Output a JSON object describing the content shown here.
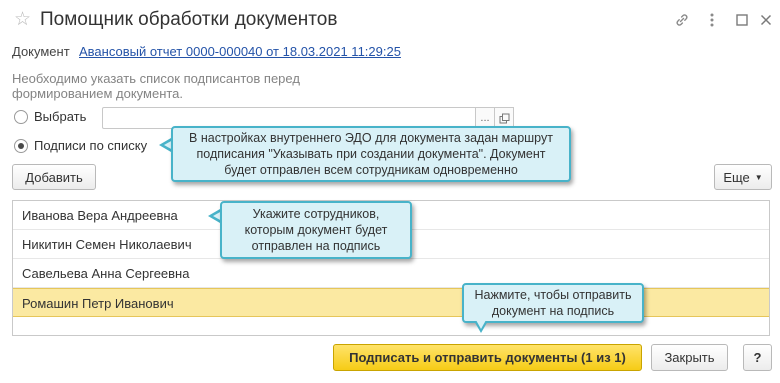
{
  "window": {
    "title": "Помощник обработки документов"
  },
  "document": {
    "label": "Документ",
    "link_text": "Авансовый отчет 0000-000040 от 18.03.2021 11:29:25"
  },
  "hint": "Необходимо указать список подписантов перед формированием документа.",
  "radios": {
    "choose_label": "Выбрать",
    "by_list_label": "Подписи по списку",
    "selected": "by_list"
  },
  "select_field": {
    "value": "",
    "ellipsis": "...",
    "open_icon": "open-icon"
  },
  "toolbar": {
    "add_label": "Добавить",
    "more_label": "Еще"
  },
  "signers": [
    {
      "name": "Иванова Вера Андреевна",
      "selected": false
    },
    {
      "name": "Никитин Семен Николаевич",
      "selected": false
    },
    {
      "name": "Савельева Анна Сергеевна",
      "selected": false
    },
    {
      "name": "Ромашин Петр Иванович",
      "selected": true
    }
  ],
  "callouts": {
    "route": "В настройках внутреннего ЭДО для документа задан маршрут подписания \"Указывать при создании документа\". Документ будет отправлен всем сотрудникам одновременно",
    "employees": "Укажите сотрудников, которым документ будет отправлен на подпись",
    "send": "Нажмите, чтобы отправить документ на подпись"
  },
  "footer": {
    "sign_send_label": "Подписать и отправить документы (1 из 1)",
    "close_label": "Закрыть",
    "help_label": "?"
  },
  "colors": {
    "link": "#2453a8",
    "primary_button": "#f6cc16",
    "selected_row": "#fbe9a2",
    "callout_bg": "#d9f1f7",
    "callout_border": "#48b3c9"
  }
}
